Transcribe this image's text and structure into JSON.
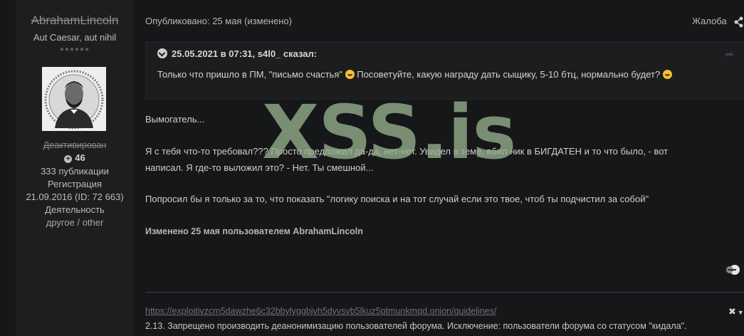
{
  "author": {
    "username": "AbrahamLincoln",
    "title": "Aut Caesar, aut nihil",
    "rank_pips": "●●●●●●",
    "group": "Деактивирован",
    "reputation": "46",
    "posts": "333 публикации",
    "registration_label": "Регистрация",
    "registration_value": "21.09.2016 (ID: 72 663)",
    "activity_label": "Деятельность",
    "activity_value": "другое / other"
  },
  "post": {
    "published": "Опубликовано: 25 мая (изменено)",
    "report_label": "Жалоба",
    "quote": {
      "header": "25.05.2021 в 07:31, s4l0_ сказал:",
      "text_before": "Только что пришло в ПМ, \"письмо счастья\"",
      "text_middle": "Посоветуйте, какую награду дать сыщику, 5-10 бтц, нормально будет?"
    },
    "paragraph1": "Вымогатель...",
    "paragraph2_line1": "Я с тебя что-то требовал??? Просто предложил да-да, нет-нет. Увидел в теме, вбил ник в БИГДАТЕН и то что было, - вот",
    "paragraph2_line2": "написал. Я где-то выложил это?  - Нет. Ты смешной...",
    "paragraph3": "Попросил бы я только за то, что показать \"логику поиска и на тот случай если это твое, чтоб ты подчистил за собой\"",
    "edited": "Изменено 25 мая пользователем AbrahamLincoln"
  },
  "watermark": "XSS.is",
  "signature": {
    "link": "https://exploitivzcm5dawzhe6c32bbylyggbjvh5dyvsvb5lkuz5ptmunkmqd.onion/guidelines/",
    "text": "2.13. Запрещено производить деанонимизацию пользователей форума. Исключение: пользователи форума со статусом \"кидала\"."
  },
  "icons": [
    "plus-circle-icon",
    "chevron-down-circle-icon",
    "share-icon",
    "quote-link-icon",
    "laughing-emoji-icon",
    "reaction-icon",
    "close-icon",
    "caret-down-icon"
  ],
  "colors": {
    "background": "#161719",
    "panel": "#1d1e20",
    "watermark": "#96b08c"
  }
}
